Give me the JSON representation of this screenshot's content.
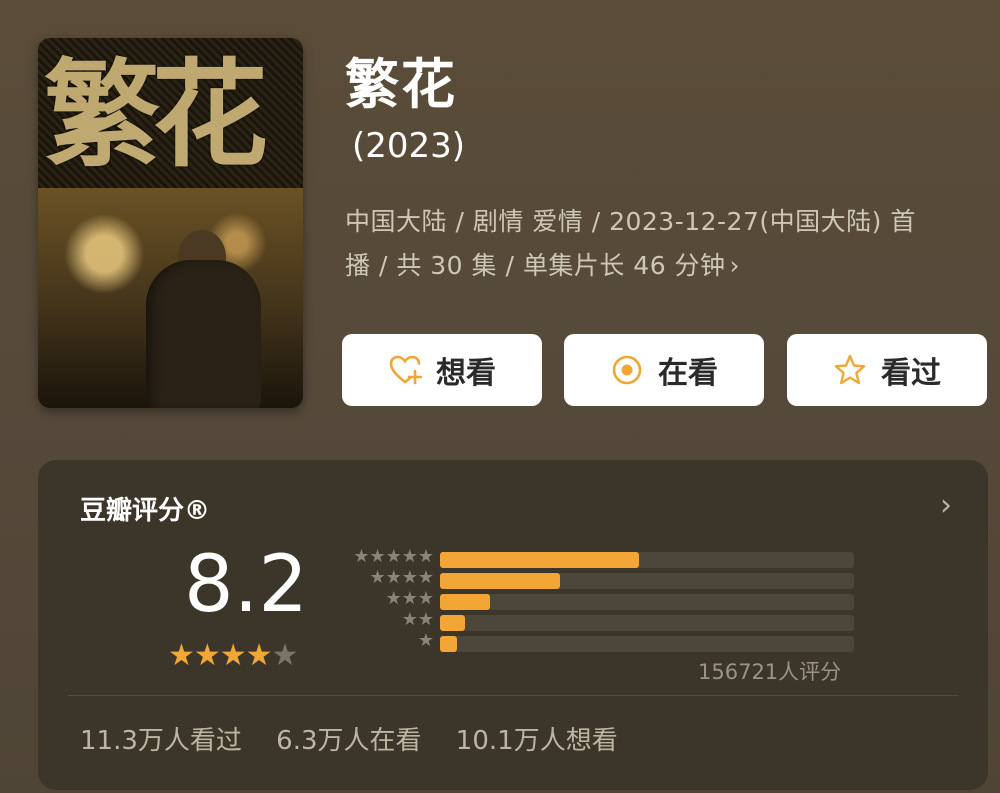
{
  "poster": {
    "title_art": "繁花"
  },
  "header": {
    "title": "繁花",
    "year": "(2023)",
    "meta_line1": "中国大陆 / 剧情 爱情 / 2023-12-27(中国大陆) 首",
    "meta_line2": "播 / 共 30 集 / 单集片长 46 分钟",
    "meta_chevron": "›"
  },
  "actions": {
    "want_label": "想看",
    "watching_label": "在看",
    "watched_label": "看过",
    "icons": [
      "heart-plus-icon",
      "target-icon",
      "star-outline-icon"
    ],
    "accent": "#f2a635"
  },
  "rating": {
    "header": "豆瓣评分®",
    "chevron": "›",
    "score": "8.2",
    "stars": 4,
    "star_on": "★★★★",
    "star_off": "★",
    "count_label": "156721人评分",
    "distribution": [
      {
        "stars": "★★★★★",
        "fraction": 0.48
      },
      {
        "stars": "★★★★",
        "fraction": 0.29
      },
      {
        "stars": "★★★",
        "fraction": 0.12
      },
      {
        "stars": "★★",
        "fraction": 0.06
      },
      {
        "stars": "★",
        "fraction": 0.04
      }
    ],
    "bar_color": "#f2a635"
  },
  "stats": {
    "watched": "11.3万人看过",
    "watching": "6.3万人在看",
    "want": "10.1万人想看"
  }
}
